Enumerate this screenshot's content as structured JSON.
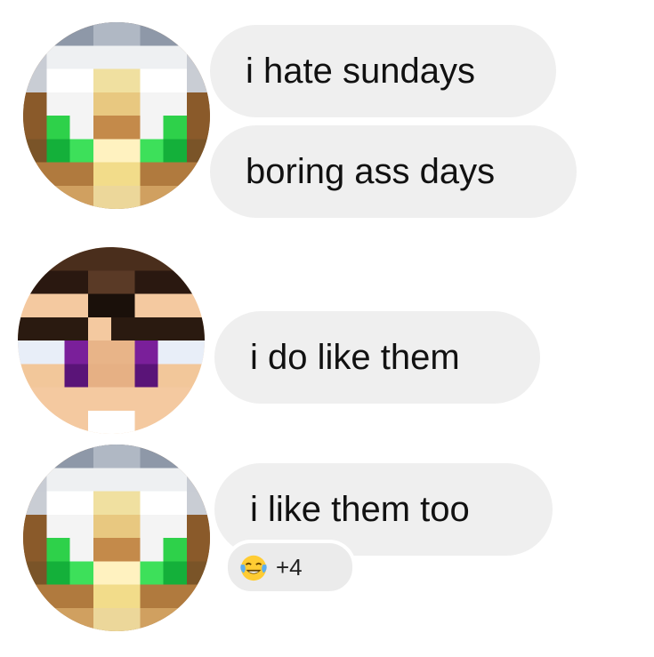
{
  "messages": [
    {
      "sender": "user-a",
      "text": "i hate sundays"
    },
    {
      "sender": "user-a",
      "text": "boring ass days"
    },
    {
      "sender": "user-b",
      "text": "i do like them"
    },
    {
      "sender": "user-a",
      "text": "i like them too"
    }
  ],
  "reaction": {
    "emoji": "face-with-tears-of-joy-icon",
    "count_label": "+4"
  },
  "colors": {
    "bubble": "#efefef",
    "text": "#111111"
  }
}
